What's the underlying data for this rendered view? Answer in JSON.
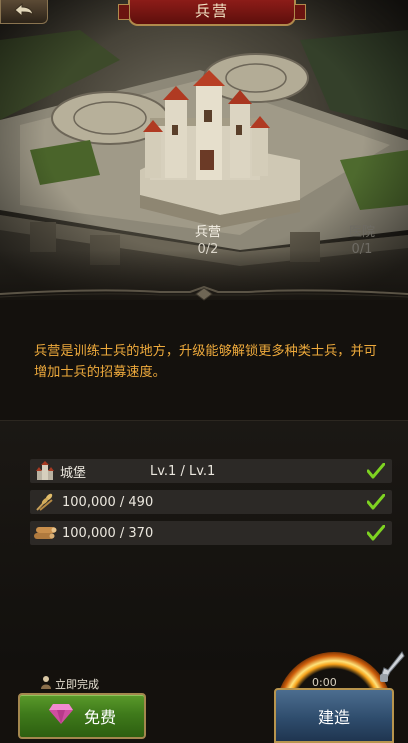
{
  "header": {
    "title": "兵营",
    "back_icon": "back-arrow-icon"
  },
  "map": {
    "barracks": {
      "name": "兵营",
      "count": "0/2"
    },
    "hospital": {
      "name": "医院",
      "count": "0/1"
    }
  },
  "description": "兵营是训练士兵的地方，升级能够解锁更多种类士兵，并可增加士兵的招募速度。",
  "requirements": [
    {
      "icon": "castle-icon",
      "name": "城堡",
      "value": "Lv.1 / Lv.1",
      "met": true
    },
    {
      "icon": "food-icon",
      "name": "",
      "value": "100,000 / 490",
      "met": true
    },
    {
      "icon": "wood-icon",
      "name": "",
      "value": "100,000 / 370",
      "met": true
    }
  ],
  "actions": {
    "instant_label": "立即完成",
    "free_label": "免费",
    "timer": "0:00",
    "build_label": "建造"
  },
  "colors": {
    "description_text": "#eeaa3c",
    "check": "#7ed321",
    "free_button": "#3f7a1b",
    "build_button": "#2f4d6d",
    "title_plate": "#8c1c18"
  }
}
